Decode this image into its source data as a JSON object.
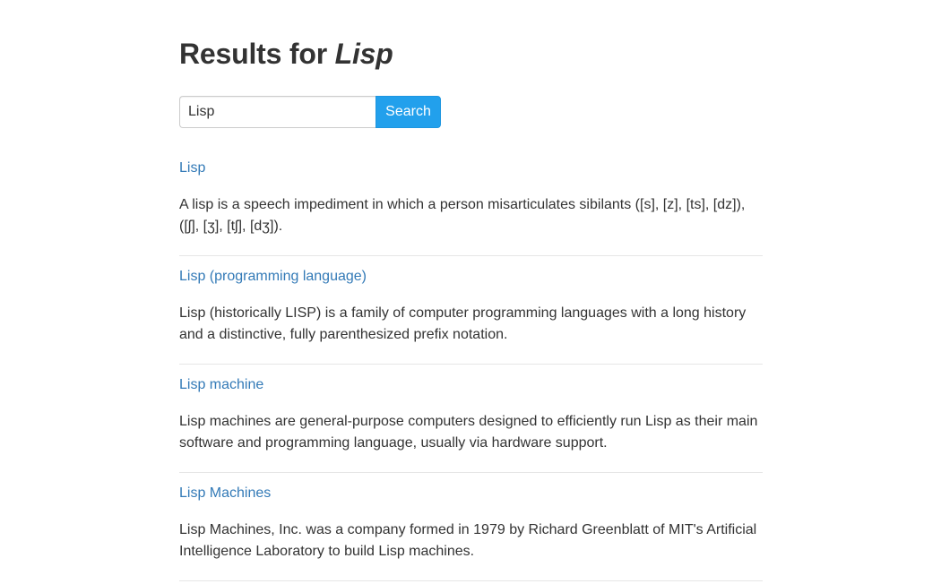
{
  "header": {
    "title_prefix": "Results for ",
    "query": "Lisp"
  },
  "search": {
    "value": "Lisp",
    "button_label": "Search"
  },
  "colors": {
    "link": "#337ab7",
    "button_bg": "#22a0ec",
    "text": "#333333"
  },
  "results": [
    {
      "title": "Lisp",
      "snippet": "A lisp is a speech impediment in which a person misarticulates sibilants ([s], [z], [ts], [dz]), ([ʃ], [ʒ], [tʃ], [dʒ])."
    },
    {
      "title": "Lisp (programming language)",
      "snippet": "Lisp (historically LISP) is a family of computer programming languages with a long history and a distinctive, fully parenthesized prefix notation."
    },
    {
      "title": "Lisp machine",
      "snippet": "Lisp machines are general-purpose computers designed to efficiently run Lisp as their main software and programming language, usually via hardware support."
    },
    {
      "title": "Lisp Machines",
      "snippet": "Lisp Machines, Inc. was a company formed in 1979 by Richard Greenblatt of MIT's Artificial Intelligence Laboratory to build Lisp machines."
    }
  ]
}
